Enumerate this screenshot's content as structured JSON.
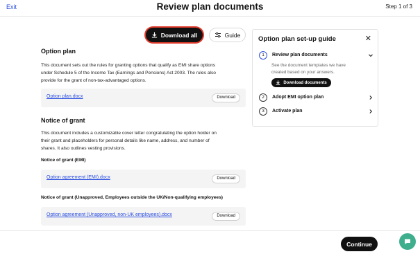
{
  "header": {
    "exit_label": "Exit",
    "title": "Review plan documents",
    "step_indicator": "Step 1 of 3"
  },
  "toolbar": {
    "download_all_label": "Download all",
    "guide_label": "Guide"
  },
  "option_plan": {
    "heading": "Option plan",
    "description_lines": [
      "This document sets out the rules for granting options that qualify as EMI share options",
      "under Schedule 5 of the Income Tax (Earnings and Pensions) Act 2003. The rules also",
      "provide for the grant of non-tax-advantaged options."
    ],
    "file": {
      "name": "Option plan.docx",
      "action": "Download"
    }
  },
  "notice_of_grant": {
    "heading": "Notice of grant",
    "description_lines": [
      "This document includes a customizable cover letter congratulating the option holder on",
      "their grant and placeholders for personal details like name, address, and number of",
      "shares. It also outlines vesting provisions."
    ],
    "emi": {
      "subheading": "Notice of grant (EMI)",
      "file": {
        "name": "Option agreement (EMI).docx",
        "action": "Download"
      }
    },
    "unapproved": {
      "subheading": "Notice of grant (Unapproved, Employees outside the UK/Non-qualifying employees)",
      "file": {
        "name": "Option agreement (Unapproved, non-UK employees).docx",
        "action": "Download"
      }
    }
  },
  "guide": {
    "title": "Option plan set-up guide",
    "steps": [
      {
        "number": "1",
        "label": "Review plan documents"
      },
      {
        "number": "2",
        "label": "Adopt EMI option plan"
      },
      {
        "number": "3",
        "label": "Activate plan"
      }
    ],
    "description_lines": [
      "See the document templates we have",
      "created based on your answers."
    ],
    "download_documents_label": "Download documents"
  },
  "footer": {
    "continue_label": "Continue"
  },
  "colors": {
    "accent": "#111111",
    "link": "#2a4ee0",
    "highlight_ring": "#e23a2c",
    "chat": "#3fae8c"
  },
  "icons": [
    "download-icon",
    "sliders-icon",
    "close-icon",
    "chevron-down-icon",
    "chevron-right-icon",
    "chat-icon"
  ]
}
